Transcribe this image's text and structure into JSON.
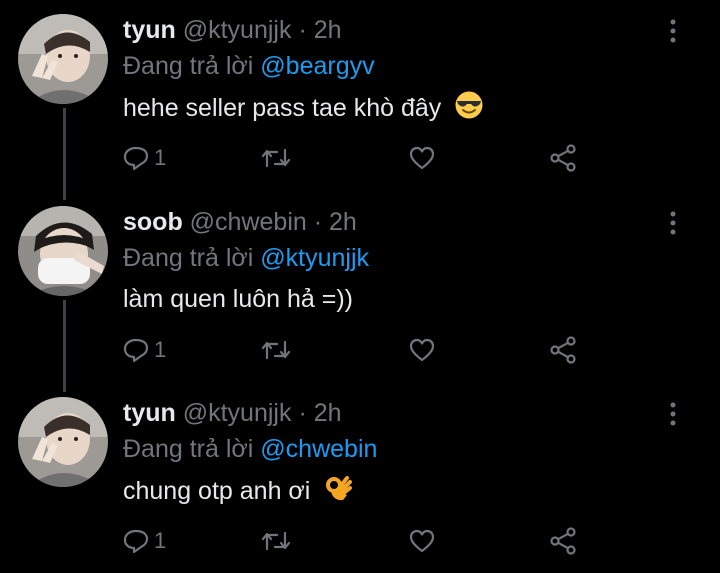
{
  "tweets": [
    {
      "name": "tyun",
      "handle": "@ktyunjjk",
      "separator": "·",
      "time": "2h",
      "reply_prefix": "Đang trả lời",
      "reply_to": "@beargyv",
      "text": "hehe seller pass tae khò đây",
      "emoji": "smiling-face-with-sunglasses-icon",
      "reply_count": "1"
    },
    {
      "name": "soob",
      "handle": "@chwebin",
      "separator": "·",
      "time": "2h",
      "reply_prefix": "Đang trả lời",
      "reply_to": "@ktyunjjk",
      "text": "làm quen luôn hả =))",
      "emoji": "",
      "reply_count": "1"
    },
    {
      "name": "tyun",
      "handle": "@ktyunjjk",
      "separator": "·",
      "time": "2h",
      "reply_prefix": "Đang trả lời",
      "reply_to": "@chwebin",
      "text": "chung otp anh ơi",
      "emoji": "ok-hand-icon",
      "reply_count": "1"
    }
  ],
  "colors": {
    "background": "#000000",
    "text": "#e7e9ea",
    "secondary": "#71767b",
    "mention": "#1d9bf0",
    "thread_line": "#3d4247"
  }
}
